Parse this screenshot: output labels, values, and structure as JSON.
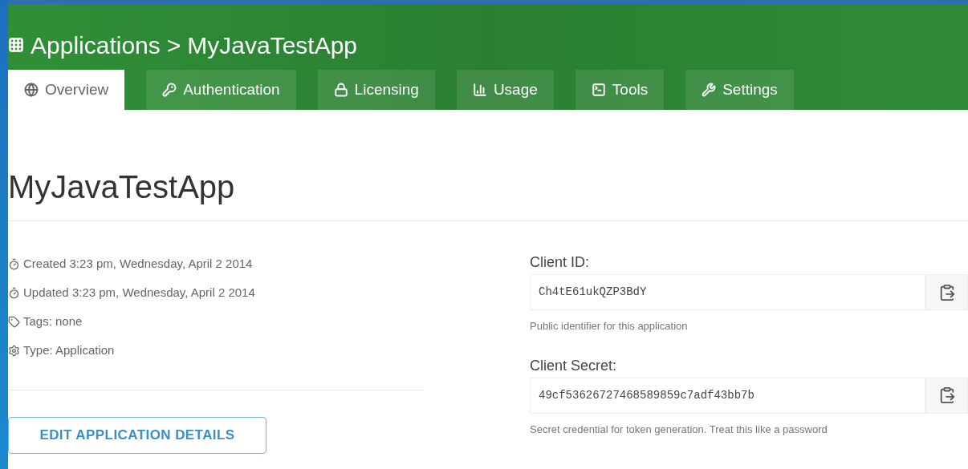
{
  "header": {
    "breadcrumb": "Applications",
    "separator": ">",
    "current": "MyJavaTestApp"
  },
  "tabs": [
    {
      "label": "Overview",
      "selected": true
    },
    {
      "label": "Authentication",
      "selected": false
    },
    {
      "label": "Licensing",
      "selected": false
    },
    {
      "label": "Usage",
      "selected": false
    },
    {
      "label": "Tools",
      "selected": false
    },
    {
      "label": "Settings",
      "selected": false
    }
  ],
  "title": "MyJavaTestApp",
  "details": [
    "Created 3:23 pm, Wednesday, April 2 2014",
    "Updated 3:23 pm, Wednesday, April 2 2014",
    "Tags: none",
    "Type: Application"
  ],
  "edit_button": "EDIT APPLICATION DETAILS",
  "credentials": [
    {
      "label": "Client ID:",
      "value": "Ch4tE61ukQZP3BdY",
      "help": "Public identifier for this application"
    },
    {
      "label": "Client Secret:",
      "value": "49cf53626727468589859c7adf43bb7b",
      "help": "Secret credential for token generation. Treat this like a password"
    }
  ]
}
